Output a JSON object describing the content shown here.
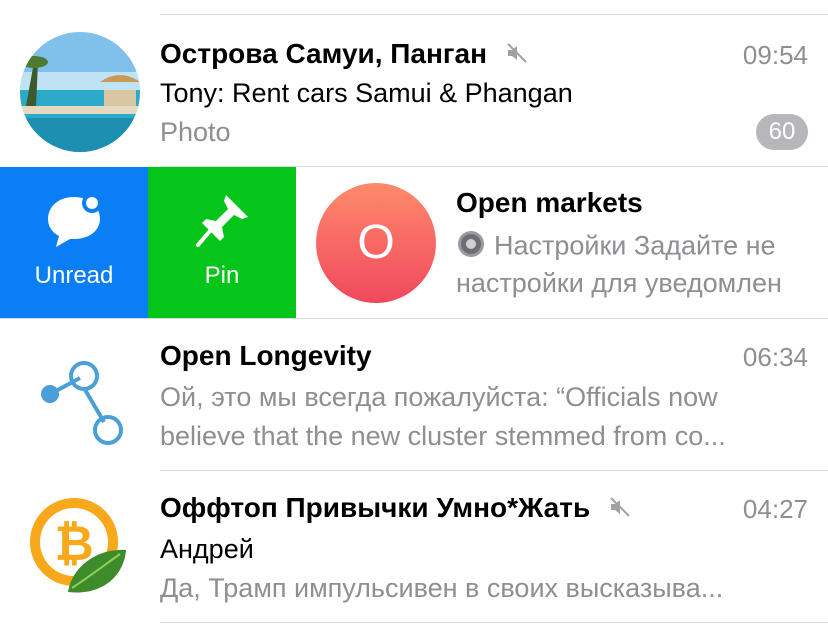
{
  "chats": [
    {
      "title": "Острова Самуи, Панган",
      "time": "09:54",
      "sender_line": "Tony: Rent cars Samui & Phangan",
      "preview": "Photo",
      "unread_count": "60",
      "muted": true,
      "avatar": "beach-photo"
    },
    {
      "title": "Open markets",
      "avatar_letter": "O",
      "preview_line1": "Настройки Задайте не",
      "preview_line2": "настройки для уведомлен",
      "preview_icon": "gear-icon",
      "swipe_actions": [
        {
          "label": "Unread",
          "icon": "unread-bubble-icon",
          "color": "#0a7ff5"
        },
        {
          "label": "Pin",
          "icon": "pin-icon",
          "color": "#06c51a"
        }
      ]
    },
    {
      "title": "Open Longevity",
      "time": "06:34",
      "preview_line1": "Ой, это мы всегда пожалуйста: “Officials now",
      "preview_line2": "believe that the new cluster stemmed from co...",
      "avatar": "molecule-logo"
    },
    {
      "title": "Оффтоп Привычки Умно*Жать",
      "time": "04:27",
      "sender_line": "Андрей",
      "preview": "Да, Трамп импульсивен в своих высказыва...",
      "muted": true,
      "avatar": "bitcoin-leaf"
    }
  ]
}
